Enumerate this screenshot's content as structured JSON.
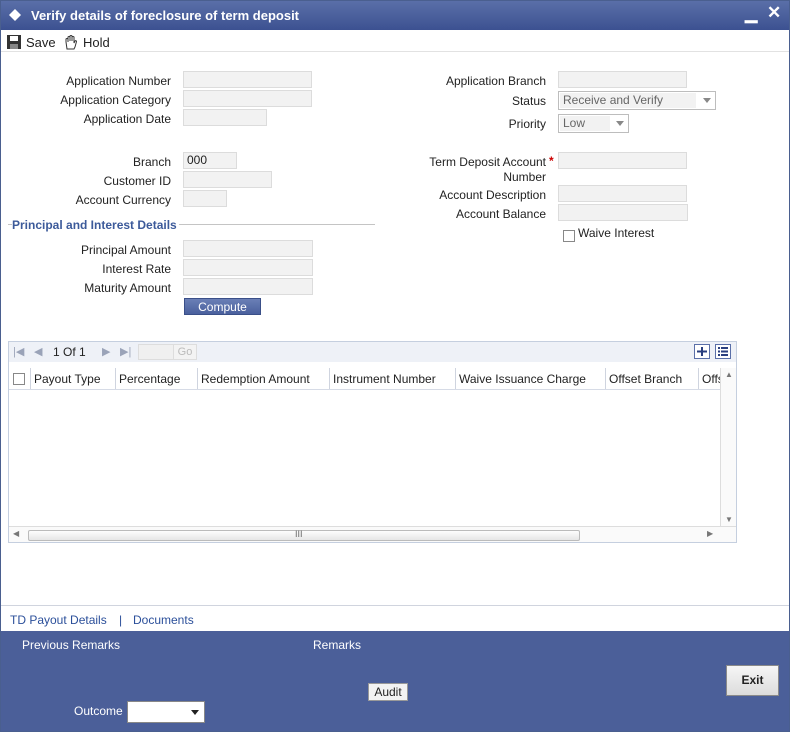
{
  "window": {
    "title": "Verify details of foreclosure of term deposit",
    "minimize": "▁",
    "close": "✕"
  },
  "toolbar": {
    "save_label": "Save",
    "hold_label": "Hold"
  },
  "form": {
    "application_number_label": "Application Number",
    "application_category_label": "Application Category",
    "application_date_label": "Application Date",
    "application_branch_label": "Application Branch",
    "status_label": "Status",
    "status_value": "Receive and Verify",
    "priority_label": "Priority",
    "priority_value": "Low",
    "branch_label": "Branch",
    "branch_value": "000",
    "customer_id_label": "Customer ID",
    "account_currency_label": "Account Currency",
    "td_account_label_line1": "Term Deposit Account",
    "td_account_label_line2": "Number",
    "required_mark": "*",
    "account_description_label": "Account Description",
    "account_balance_label": "Account Balance",
    "waive_interest_label": "Waive Interest"
  },
  "principal_section": {
    "title": "Principal and Interest Details",
    "principal_amount_label": "Principal Amount",
    "interest_rate_label": "Interest Rate",
    "maturity_amount_label": "Maturity Amount",
    "compute_label": "Compute"
  },
  "grid": {
    "page_text": "1 Of 1",
    "go_label": "Go",
    "columns": [
      "Payout Type",
      "Percentage",
      "Redemption Amount",
      "Instrument Number",
      "Waive Issuance Charge",
      "Offset Branch",
      "Offs"
    ],
    "hscroll_grip": "III"
  },
  "links": {
    "td_payout": "TD Payout Details",
    "separator": "|",
    "documents": "Documents"
  },
  "footer": {
    "previous_remarks_label": "Previous Remarks",
    "remarks_label": "Remarks",
    "audit_label": "Audit",
    "exit_label": "Exit",
    "outcome_label": "Outcome"
  }
}
